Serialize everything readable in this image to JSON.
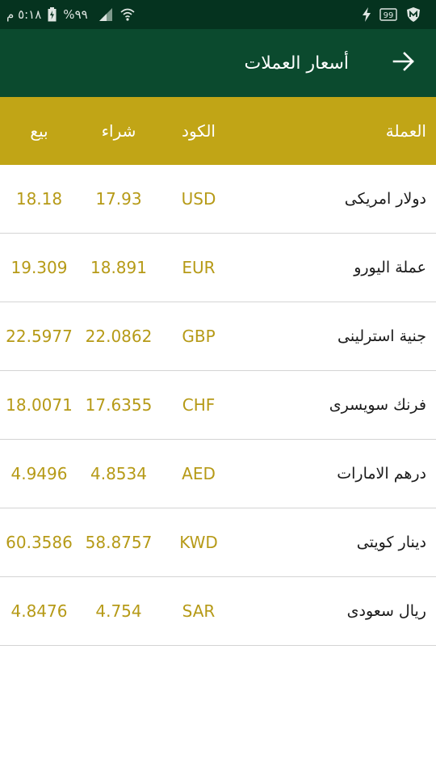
{
  "status_bar": {
    "time": "٥:١٨ م",
    "battery_percent": "%٩٩",
    "icons": [
      "battery-icon",
      "signal-icon",
      "wifi-icon",
      "shield-app-icon",
      "badge-99-icon",
      "charging-bolt-icon"
    ]
  },
  "app_bar": {
    "title": "أسعار العملات",
    "back_icon": "arrow-right-icon",
    "color": "#0b4a2e"
  },
  "table": {
    "header_color": "#c1a516",
    "value_color": "#b69a17",
    "headers": {
      "name": "العملة",
      "code": "الكود",
      "buy": "شراء",
      "sell": "بيع"
    },
    "rows": [
      {
        "name": "دولار امريكى",
        "code": "USD",
        "buy": "17.93",
        "sell": "18.18"
      },
      {
        "name": "عملة اليورو",
        "code": "EUR",
        "buy": "18.891",
        "sell": "19.309"
      },
      {
        "name": "جنية استرلينى",
        "code": "GBP",
        "buy": "22.0862",
        "sell": "22.5977"
      },
      {
        "name": "فرنك سويسرى",
        "code": "CHF",
        "buy": "17.6355",
        "sell": "18.0071"
      },
      {
        "name": "درهم الامارات",
        "code": "AED",
        "buy": "4.8534",
        "sell": "4.9496"
      },
      {
        "name": "دينار كويتى",
        "code": "KWD",
        "buy": "58.8757",
        "sell": "60.3586"
      },
      {
        "name": "ريال سعودى",
        "code": "SAR",
        "buy": "4.754",
        "sell": "4.8476"
      }
    ]
  }
}
